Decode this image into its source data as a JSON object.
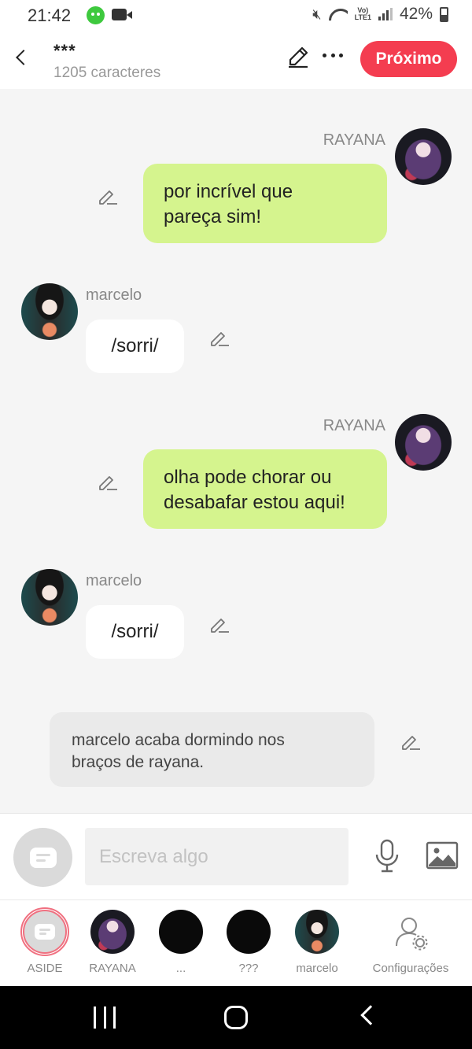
{
  "status_bar": {
    "time": "21:42",
    "volte": "Vo)",
    "lte": "LTE1",
    "battery": "42%"
  },
  "header": {
    "title": "***",
    "subtitle": "1205 caracteres",
    "next_label": "Próximo",
    "accent_color": "#f43d50"
  },
  "messages": [
    {
      "side": "right",
      "sender": "RAYANA",
      "text_lines": [
        "por incrível que",
        "pareça sim!"
      ]
    },
    {
      "side": "left",
      "sender": "marcelo",
      "text": "/sorri/"
    },
    {
      "side": "right",
      "sender": "RAYANA",
      "text_lines": [
        "olha pode chorar ou",
        "desabafar estou aqui!"
      ]
    },
    {
      "side": "left",
      "sender": "marcelo",
      "text": "/sorri/"
    },
    {
      "side": "aside",
      "text_lines": [
        "marcelo acaba dormindo nos",
        "braços de rayana."
      ]
    }
  ],
  "bubble_colors": {
    "me": "#d5f48e",
    "other": "#ffffff",
    "aside": "#eaeaea"
  },
  "composer": {
    "placeholder": "Escreva algo",
    "aside_icon": "chat-bubble-icon",
    "mic_icon": "microphone-icon",
    "image_icon": "image-icon"
  },
  "characters": [
    {
      "label": "ASIDE",
      "selected": true
    },
    {
      "label": "RAYANA"
    },
    {
      "label": "..."
    },
    {
      "label": "???"
    },
    {
      "label": "marcelo"
    },
    {
      "label": "Configurações",
      "icon": "user-settings-icon"
    }
  ]
}
